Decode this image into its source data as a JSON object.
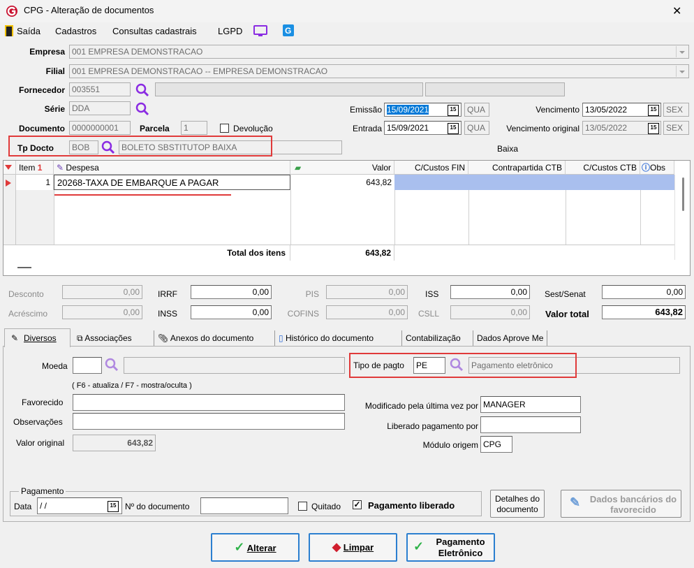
{
  "window": {
    "title": "CPG - Alteração de documentos",
    "close": "✕"
  },
  "menu": [
    "Saída",
    "Cadastros",
    "Consultas cadastrais",
    "LGPD"
  ],
  "labels": {
    "empresa": "Empresa",
    "filial": "Filial",
    "fornecedor": "Fornecedor",
    "serie": "Série",
    "documento": "Documento",
    "parcela": "Parcela",
    "devolucao": "Devolução",
    "tp_docto": "Tp Docto",
    "emissao": "Emissão",
    "entrada": "Entrada",
    "vencimento": "Vencimento",
    "vencimento_original": "Vencimento original",
    "baixa": "Baixa"
  },
  "form": {
    "empresa": "001 EMPRESA DEMONSTRACAO",
    "filial": "001 EMPRESA DEMONSTRACAO -- EMPRESA DEMONSTRACAO",
    "fornecedor": "003551",
    "serie": "DDA",
    "documento": "0000000001",
    "parcela": "1",
    "tp_docto_code": "BOB",
    "tp_docto_desc": "BOLETO SBSTITUTOP BAIXA",
    "emissao": "15/09/2021",
    "emissao_dow": "QUA",
    "entrada": "15/09/2021",
    "entrada_dow": "QUA",
    "vencimento": "13/05/2022",
    "vencimento_dow": "SEX",
    "vencimento_original": "13/05/2022",
    "vencimento_original_dow": "SEX",
    "cal_icon": "15"
  },
  "grid": {
    "headers": {
      "item": "Item",
      "sort": "1",
      "despesa": "Despesa",
      "valor": "Valor",
      "cc_fin": "C/Custos FIN",
      "contrapartida": "Contrapartida CTB",
      "cc_ctb": "C/Custos CTB",
      "obs": "Obs"
    },
    "rows": [
      {
        "item": "1",
        "despesa": "20268-TAXA DE EMBARQUE A PAGAR",
        "valor": "643,82"
      }
    ],
    "total_label": "Total dos itens",
    "total_value": "643,82"
  },
  "totals": {
    "desconto_l": "Desconto",
    "desconto": "0,00",
    "acrescimo_l": "Acréscimo",
    "acrescimo": "0,00",
    "irrf_l": "IRRF",
    "irrf": "0,00",
    "inss_l": "INSS",
    "inss": "0,00",
    "pis_l": "PIS",
    "pis": "0,00",
    "cofins_l": "COFINS",
    "cofins": "0,00",
    "iss_l": "ISS",
    "iss": "0,00",
    "csll_l": "CSLL",
    "csll": "0,00",
    "sest_l": "Sest/Senat",
    "sest": "0,00",
    "valor_total_l": "Valor total",
    "valor_total": "643,82"
  },
  "tabs": [
    "Diversos",
    "Associações",
    "Anexos do documento",
    "Histórico do documento",
    "Contabilização",
    "Dados Aprove Me"
  ],
  "diversos": {
    "moeda_l": "Moeda",
    "moeda": "",
    "hint": "( F6 - atualiza / F7 - mostra/oculta )",
    "favorecido_l": "Favorecido",
    "observacoes_l": "Observações",
    "valor_original_l": "Valor original",
    "valor_original": "643,82",
    "tipo_pagto_l": "Tipo de pagto",
    "tipo_pagto": "PE",
    "tipo_pagto_desc": "Pagamento eletrônico",
    "modificado_l": "Modificado pela última vez por",
    "modificado": "MANAGER",
    "liberado_l": "Liberado pagamento por",
    "liberado": "",
    "modulo_l": "Módulo origem",
    "modulo": "CPG"
  },
  "pagamento": {
    "group": "Pagamento",
    "data_l": "Data",
    "data": " /  /",
    "ndoc_l": "Nº do documento",
    "ndoc": "",
    "quitado_l": "Quitado",
    "liberado_l": "Pagamento liberado",
    "detalhes": "Detalhes do documento",
    "dados_bancarios": "Dados bancários do favorecido"
  },
  "buttons": {
    "alterar": "Alterar",
    "limpar": "Limpar",
    "pagamento_eletronico": "Pagamento Eletrônico"
  },
  "colors": {
    "accent_red": "#e03a3a",
    "selection": "#0078d7",
    "magnifier": "#8a2be2"
  }
}
